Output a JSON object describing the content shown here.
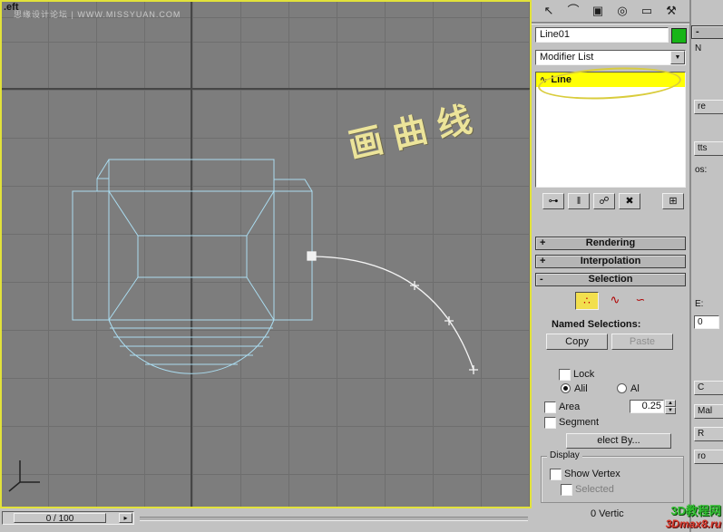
{
  "window": {
    "viewport_label": ".eft",
    "watermark_top": "思缘设计论坛 | WWW.MISSYUAN.COM",
    "annotation_text": "画曲线",
    "time_slider_value": "0 / 100",
    "time_arrow": "▸",
    "status_vertices": "0 Vertic"
  },
  "watermark_bottom_right": {
    "line1": "3D教程网",
    "line2": "3Dmax8.ru"
  },
  "command_panel": {
    "tabs": [
      {
        "name": "select",
        "glyph": "↖"
      },
      {
        "name": "modify",
        "glyph": "⌒"
      },
      {
        "name": "hierarchy",
        "glyph": "▣"
      },
      {
        "name": "motion",
        "glyph": "◎"
      },
      {
        "name": "display",
        "glyph": "▭"
      },
      {
        "name": "utilities",
        "glyph": "⚒"
      }
    ],
    "object_name": "Line01",
    "modifier_list_label": "Modifier List",
    "dropdown_arrow": "▼",
    "modifier_stack": {
      "selected_item": "Line",
      "item_glyph": "∿"
    },
    "stack_tools": [
      {
        "name": "pin-stack",
        "glyph": "⊶"
      },
      {
        "name": "show-end-result",
        "glyph": "‖"
      },
      {
        "name": "make-unique",
        "glyph": "☍"
      },
      {
        "name": "remove-modifier",
        "glyph": "✖"
      },
      {
        "name": "configure-modifier-sets",
        "glyph": "⊞"
      }
    ],
    "rollouts": {
      "rendering": {
        "sign": "+",
        "title": "Rendering"
      },
      "interpolation": {
        "sign": "+",
        "title": "Interpolation"
      },
      "selection": {
        "sign": "-",
        "title": "Selection"
      }
    },
    "selection_rollout": {
      "vertex_glyph": "∴",
      "segment_glyph": "∿",
      "spline_glyph": "∽",
      "named_selections_label": "Named Selections:",
      "copy": "Copy",
      "paste": "Paste",
      "lock": "Lock",
      "radio_alike": "Alil",
      "radio_all": "Al",
      "area": "Area",
      "area_value": "0.25",
      "segment": "Segment",
      "select_by": "elect By...",
      "spinner_up": "▲",
      "spinner_down": "▼",
      "display_title": "Display",
      "show_vertex": "Show Vertex",
      "selected": "Selected"
    }
  },
  "right_strip": {
    "header": "-",
    "items": [
      {
        "label": "N"
      },
      {
        "label": "re"
      },
      {
        "label": "tts"
      },
      {
        "label": "os:"
      },
      {
        "label": "E:"
      },
      {
        "label": "0"
      },
      {
        "label": "C"
      },
      {
        "label": "Mal"
      },
      {
        "label": "R"
      },
      {
        "label": "ro"
      }
    ]
  },
  "colors": {
    "viewport_border_yellow": "#e2e23a",
    "wireframe_blue": "#aadcf0",
    "stack_highlight_yellow": "#ffff05",
    "name_swatch_green": "#17b517",
    "annotation_yellow": "#ece49a"
  }
}
